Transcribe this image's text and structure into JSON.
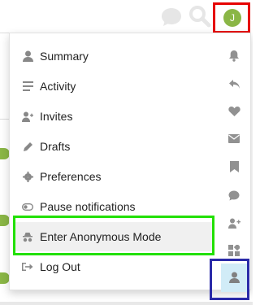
{
  "header": {
    "chat_icon": "chat-bubble-icon",
    "search_icon": "search-icon",
    "avatar_letter": "J",
    "avatar_color": "#8ab646",
    "highlight_color": "#e60000"
  },
  "menu": {
    "items": [
      {
        "label": "Summary",
        "icon": "user-icon"
      },
      {
        "label": "Activity",
        "icon": "list-icon"
      },
      {
        "label": "Invites",
        "icon": "user-plus-icon"
      },
      {
        "label": "Drafts",
        "icon": "pencil-icon"
      },
      {
        "label": "Preferences",
        "icon": "gear-icon"
      },
      {
        "label": "Pause notifications",
        "icon": "toggle-icon"
      },
      {
        "label": "Enter Anonymous Mode",
        "icon": "incognito-icon"
      },
      {
        "label": "Log Out",
        "icon": "sign-out-icon"
      }
    ],
    "active_item": "Enter Anonymous Mode",
    "highlight_color": "#22e000"
  },
  "side_rail": {
    "icons": [
      "bell-icon",
      "reply-icon",
      "heart-icon",
      "envelope-icon",
      "bookmark-icon",
      "chat-bubble-icon",
      "user-plus-icon",
      "puzzle-icon",
      "profile-icon"
    ],
    "active_icon": "profile-icon",
    "active_bg": "#d1ecf7",
    "highlight_color": "#2a2aa8"
  }
}
